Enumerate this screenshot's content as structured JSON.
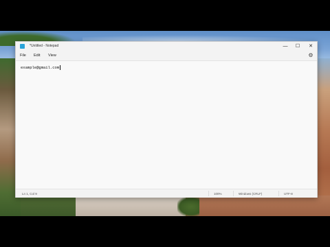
{
  "window": {
    "title": "*Untitled - Notepad",
    "controls": {
      "minimize": "—",
      "maximize": "☐",
      "close": "✕"
    }
  },
  "menu": {
    "items": [
      "File",
      "Edit",
      "View"
    ],
    "settings_icon": "gear-icon"
  },
  "editor": {
    "text": "example@gmail.com"
  },
  "statusbar": {
    "position": "Ln 1, Col 9",
    "zoom": "100%",
    "line_endings": "Windows (CRLF)",
    "encoding": "UTF-8"
  },
  "colors": {
    "app_icon": "#2aa3d8",
    "window_bg": "#f9f9f9",
    "chrome_bg": "#f3f3f3"
  }
}
